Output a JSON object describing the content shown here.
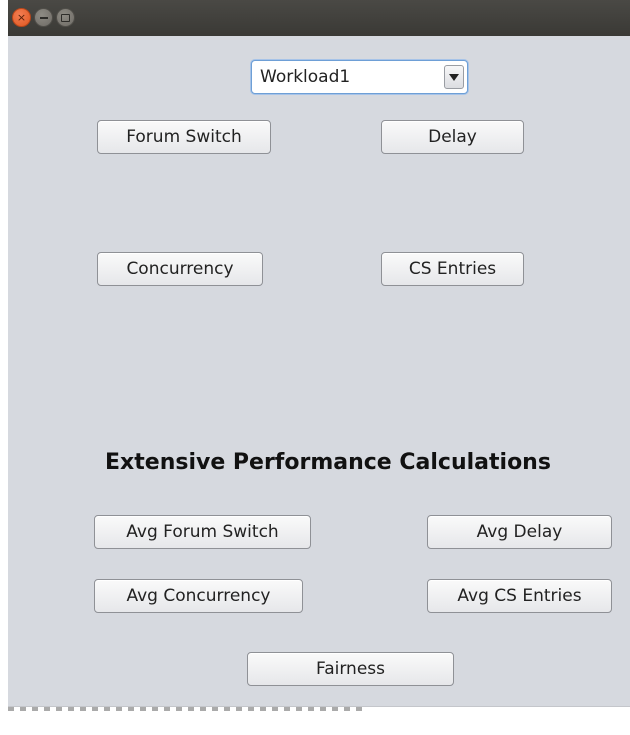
{
  "window": {
    "controls": {
      "close_icon": "close-icon",
      "minimize_icon": "minimize-icon",
      "maximize_icon": "maximize-icon"
    }
  },
  "workload_select": {
    "value": "Workload1"
  },
  "buttons": {
    "forum_switch": "Forum Switch",
    "delay": "Delay",
    "concurrency": "Concurrency",
    "cs_entries": "CS Entries"
  },
  "extensive": {
    "heading": "Extensive Performance Calculations",
    "avg_forum_switch": "Avg Forum Switch",
    "avg_delay": "Avg Delay",
    "avg_concurrency": "Avg Concurrency",
    "avg_cs_entries": "Avg CS Entries",
    "fairness": "Fairness"
  },
  "colors": {
    "close_button": "#e0561f",
    "panel_background": "#d6d9df",
    "titlebar": "#3a3935",
    "combo_focus": "#6e9fd6"
  }
}
